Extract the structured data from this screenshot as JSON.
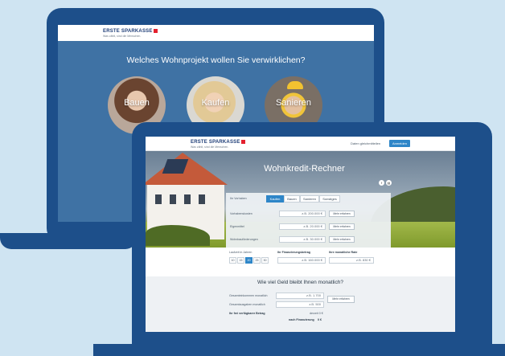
{
  "brand": {
    "name": "ERSTE SPARKASSE",
    "tagline": "Was zählt, sind die Menschen."
  },
  "back_screen": {
    "question": "Welches Wohnprojekt wollen Sie verwirklichen?",
    "options": [
      {
        "label": "Bauen"
      },
      {
        "label": "Kaufen"
      },
      {
        "label": "Sanieren"
      }
    ]
  },
  "front_header": {
    "link": "Daten gleichmitteilen",
    "button": "Anmelden"
  },
  "hero": {
    "title": "Wohnkredit-Rechner"
  },
  "calculator": {
    "intent_label": "Ihr Vorhaben",
    "tabs": [
      "Kaufen",
      "Bauen",
      "Sanieren",
      "Sonstiges"
    ],
    "active_tab": "Kaufen",
    "rows": [
      {
        "label": "Vorhabenskosten",
        "value": "z.B. 200.000 €",
        "button": "Mehr erfahren"
      },
      {
        "label": "Eigenmittel",
        "value": "z.B. 20.000 €",
        "button": "Mehr erfahren"
      },
      {
        "label": "Wohnbauförderungen",
        "value": "z.B. 30.000 €",
        "button": "Mehr erfahren"
      }
    ]
  },
  "financing": {
    "term_label": "Laufzeit in Jahren",
    "terms": [
      "10",
      "15",
      "20",
      "25",
      "30"
    ],
    "active_term": "20",
    "amount_label": "Ihr Finanzierungsbetrag",
    "amount_value": "z.B. 160.000 €",
    "rate_label": "Ihre monatliche Rate",
    "rate_value": "z.B. 830 €"
  },
  "budget": {
    "title": "Wie viel Geld bleibt Ihnen monatlich?",
    "income_label": "Gesamteinkommen monatlich",
    "income_value": "z.B. 1.700",
    "expenses_label": "Gesamtausgaben monatlich",
    "expenses_value": "z.B. 500",
    "button": "Mehr erfahren",
    "available_label": "Ihr frei verfügbarer Betrag",
    "available_value": "derzeit 0 €",
    "financing_label": "nach Finanzierung",
    "financing_value": "0 €"
  },
  "colors": {
    "laptop_frame": "#1d4f8a",
    "back_screen_bg": "#3f72a4",
    "accent": "#2e86c8",
    "page_bg": "#cfe4f2"
  }
}
